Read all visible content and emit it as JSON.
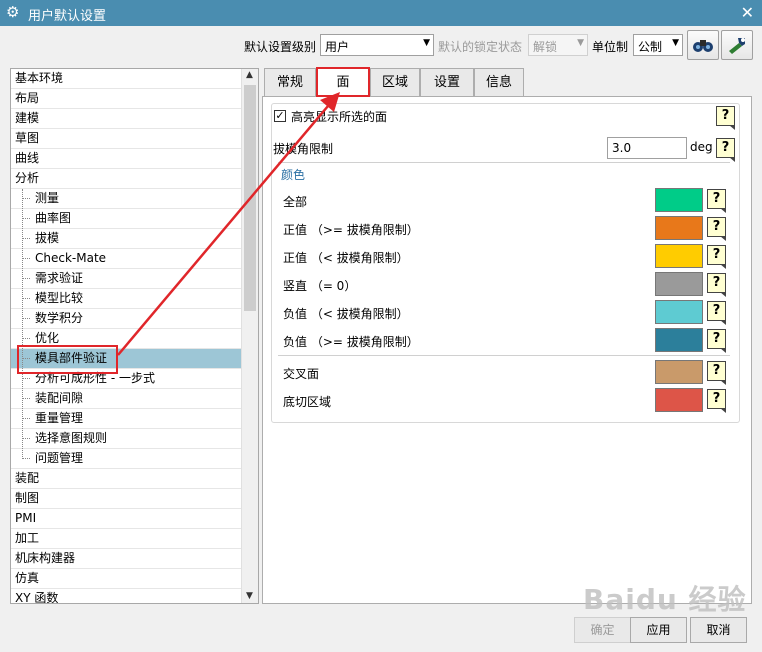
{
  "window": {
    "title": "用户默认设置"
  },
  "toolbar": {
    "level_label": "默认设置级别",
    "level_value": "用户",
    "lock_label": "默认的锁定状态",
    "lock_value": "解锁",
    "unit_label": "单位制",
    "unit_value": "公制"
  },
  "tree": {
    "items": [
      {
        "label": "基本环境",
        "level": 0
      },
      {
        "label": "布局",
        "level": 0
      },
      {
        "label": "建模",
        "level": 0
      },
      {
        "label": "草图",
        "level": 0
      },
      {
        "label": "曲线",
        "level": 0
      },
      {
        "label": "分析",
        "level": 0
      },
      {
        "label": "测量",
        "level": 1
      },
      {
        "label": "曲率图",
        "level": 1
      },
      {
        "label": "拔模",
        "level": 1
      },
      {
        "label": "Check-Mate",
        "level": 1
      },
      {
        "label": "需求验证",
        "level": 1
      },
      {
        "label": "模型比较",
        "level": 1
      },
      {
        "label": "数学积分",
        "level": 1
      },
      {
        "label": "优化",
        "level": 1
      },
      {
        "label": "模具部件验证",
        "level": 1,
        "selected": true
      },
      {
        "label": "分析可成形性 - 一步式",
        "level": 1
      },
      {
        "label": "装配间隙",
        "level": 1
      },
      {
        "label": "重量管理",
        "level": 1
      },
      {
        "label": "选择意图规则",
        "level": 1
      },
      {
        "label": "问题管理",
        "level": 1
      },
      {
        "label": "装配",
        "level": 0
      },
      {
        "label": "制图",
        "level": 0
      },
      {
        "label": "PMI",
        "level": 0
      },
      {
        "label": "加工",
        "level": 0
      },
      {
        "label": "机床构建器",
        "level": 0
      },
      {
        "label": "仿真",
        "level": 0
      },
      {
        "label": "XY 函数",
        "level": 0
      }
    ]
  },
  "tabs": [
    "常规",
    "面",
    "区域",
    "设置",
    "信息"
  ],
  "active_tab": "面",
  "face_tab": {
    "highlight_label": "高亮显示所选的面",
    "highlight_checked": true,
    "draft_label": "拔模角限制",
    "draft_value": "3.0",
    "draft_unit": "deg",
    "color_group_label": "颜色",
    "colors": [
      {
        "label": "全部",
        "color": "#00cc88"
      },
      {
        "label": "正值 （>= 拔模角限制）",
        "color": "#e8781a"
      },
      {
        "label": "正值 （< 拔模角限制）",
        "color": "#ffcc00"
      },
      {
        "label": "竖直 （= 0）",
        "color": "#9a9a9a"
      },
      {
        "label": "负值 （< 拔模角限制）",
        "color": "#5ecbd2"
      },
      {
        "label": "负值 （>= 拔模角限制）",
        "color": "#2c7f9b"
      },
      {
        "label": "交叉面",
        "color": "#c99a6a"
      },
      {
        "label": "底切区域",
        "color": "#dd5548"
      }
    ],
    "help_symbol": "?"
  },
  "buttons": {
    "ok": "确定",
    "apply": "应用",
    "cancel": "取消"
  },
  "watermark": "Baidu 经验",
  "annotation_color": "#e0262a"
}
